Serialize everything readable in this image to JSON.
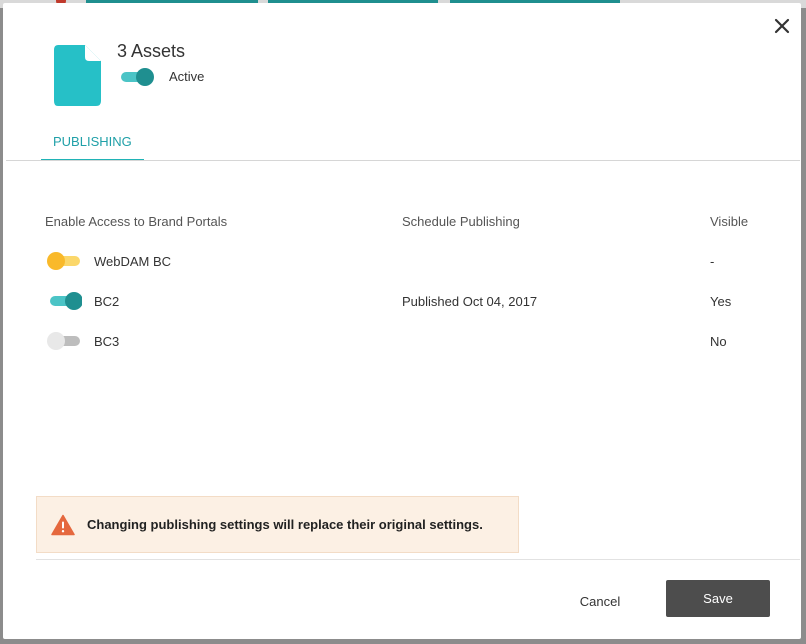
{
  "modal": {
    "title": "3 Assets",
    "status_label": "Active",
    "status_on": true
  },
  "tabs": [
    {
      "label": "PUBLISHING"
    }
  ],
  "table": {
    "headers": {
      "access": "Enable Access to Brand Portals",
      "schedule": "Schedule Publishing",
      "visible": "Visible"
    },
    "rows": [
      {
        "portal": "WebDAM BC",
        "toggle_state": "partial",
        "schedule": "",
        "visible": "-"
      },
      {
        "portal": "BC2",
        "toggle_state": "on",
        "schedule": "Published Oct 04, 2017",
        "visible": "Yes"
      },
      {
        "portal": "BC3",
        "toggle_state": "off",
        "schedule": "",
        "visible": "No"
      }
    ]
  },
  "warning": {
    "text": "Changing publishing settings will replace their original settings."
  },
  "footer": {
    "cancel_label": "Cancel",
    "save_label": "Save"
  },
  "icons": {
    "file": "file-icon",
    "close": "close-icon",
    "warning": "warning-triangle-icon"
  },
  "colors": {
    "accent": "#20b3b6",
    "toggle_on": "#1f8f90",
    "toggle_partial": "#f9b92a",
    "toggle_off": "#bdbdbd",
    "warning_icon": "#e5683e",
    "warning_bg": "#fcf0e4",
    "save_button": "#4d4d4d"
  }
}
